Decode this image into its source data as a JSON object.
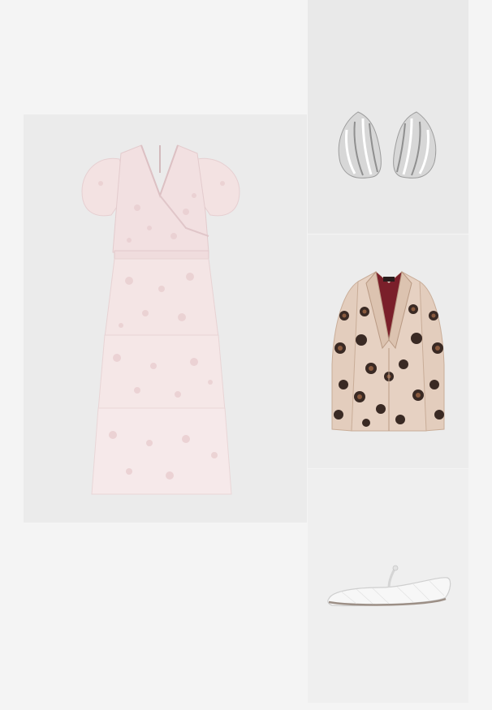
{
  "collage": {
    "background": "#f4f4f4",
    "items": [
      {
        "id": "dress",
        "kind": "tiered-lace-midi-dress",
        "colors": {
          "fabric": "#f3e2e2",
          "lace": "#ead0d2",
          "tile": "#ebebeb"
        }
      },
      {
        "id": "earrings",
        "kind": "silver-shell-earrings",
        "colors": {
          "metal": "#d7d7d7",
          "highlight": "#ffffff",
          "shadow": "#9d9d9d",
          "tile": "#e9e9e9"
        }
      },
      {
        "id": "blazer",
        "kind": "leopard-print-blazer",
        "colors": {
          "base": "#e3cdbd",
          "spot": "#3a2a24",
          "spot_inner": "#8a5a3e",
          "lining": "#7a1f2a",
          "tile": "#ececec"
        }
      },
      {
        "id": "flats",
        "kind": "white-mesh-ballet-flat",
        "colors": {
          "mesh": "#f7f7f7",
          "outline": "#cfcfcf",
          "sole": "#9c8f86",
          "tile": "#efefef"
        }
      }
    ]
  }
}
